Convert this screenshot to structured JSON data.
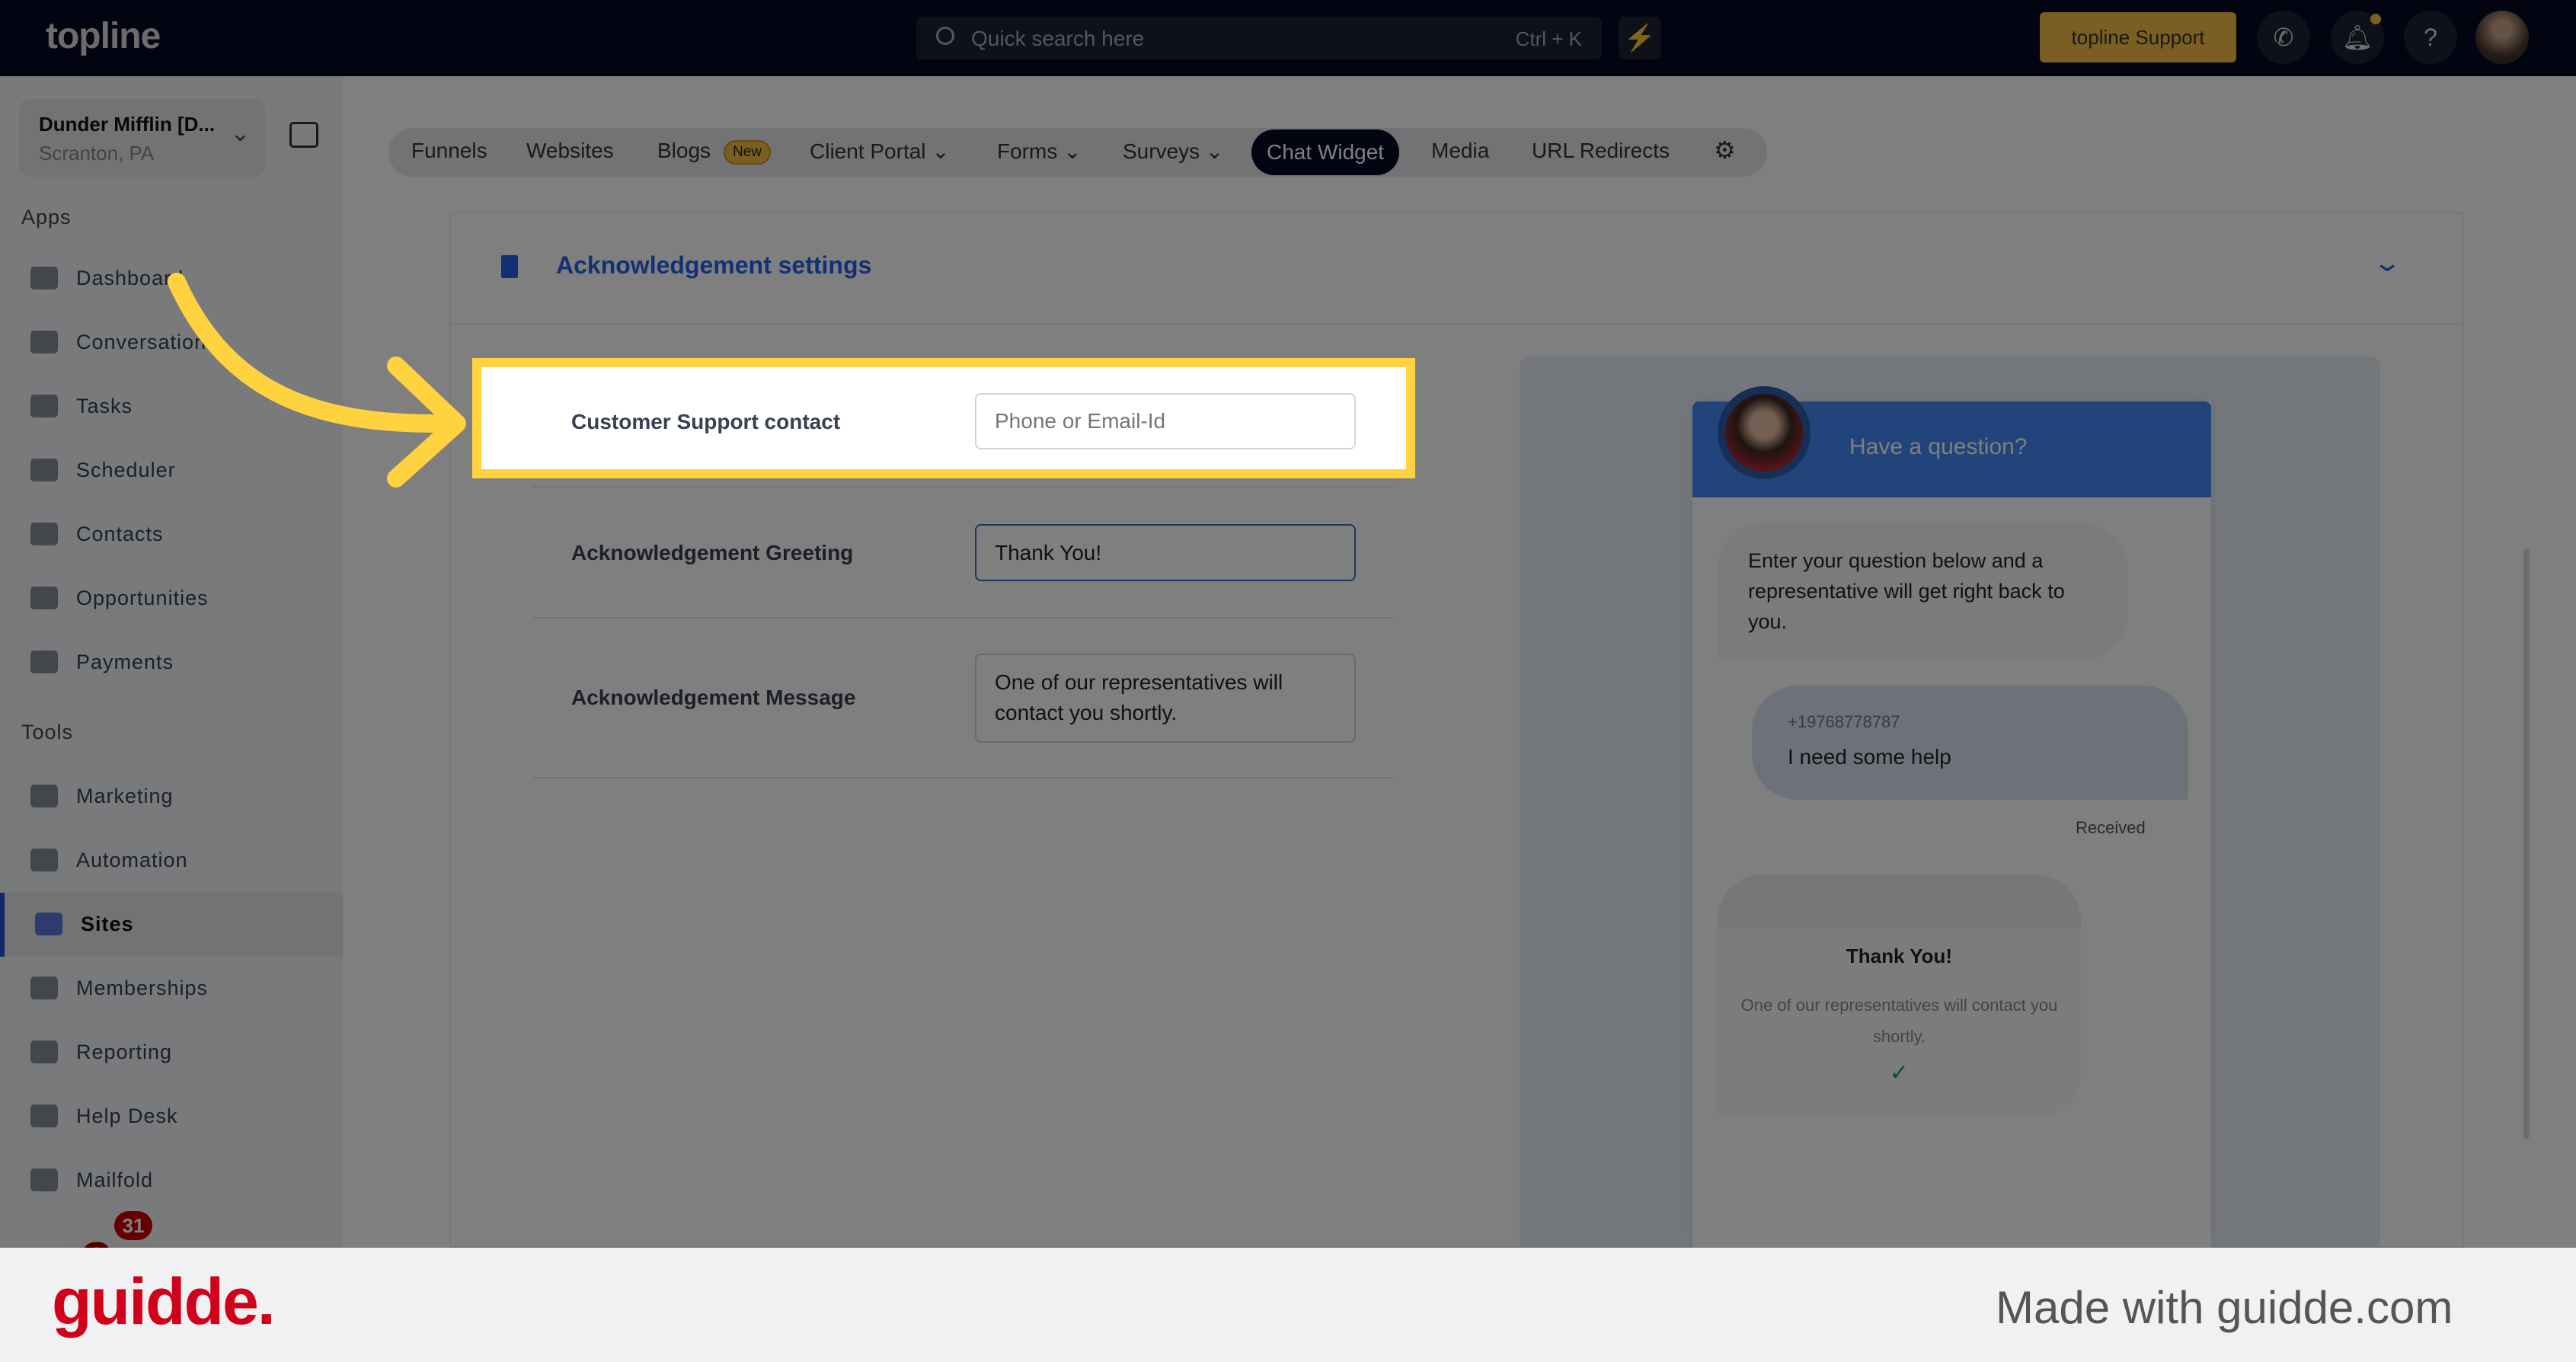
{
  "topbar": {
    "logo": "topline",
    "search_placeholder": "Quick search here",
    "search_shortcut": "Ctrl + K",
    "support_label": "topline Support",
    "accent": "#f4bd44"
  },
  "workspace": {
    "name": "Dunder Mifflin [D...",
    "location": "Scranton, PA"
  },
  "sidebar": {
    "apps_label": "Apps",
    "tools_label": "Tools",
    "apps": [
      {
        "label": "Dashboard",
        "icon": "dashboard-icon"
      },
      {
        "label": "Conversations",
        "icon": "chat-icon"
      },
      {
        "label": "Tasks",
        "icon": "tasks-icon"
      },
      {
        "label": "Scheduler",
        "icon": "calendar-icon"
      },
      {
        "label": "Contacts",
        "icon": "person-icon"
      },
      {
        "label": "Opportunities",
        "icon": "target-icon"
      },
      {
        "label": "Payments",
        "icon": "card-icon"
      }
    ],
    "tools": [
      {
        "label": "Marketing",
        "icon": "megaphone-icon"
      },
      {
        "label": "Automation",
        "icon": "gears-icon"
      },
      {
        "label": "Sites",
        "icon": "globe-icon",
        "active": true
      },
      {
        "label": "Memberships",
        "icon": "members-icon"
      },
      {
        "label": "Reporting",
        "icon": "pie-icon"
      },
      {
        "label": "Help Desk",
        "icon": "help-icon"
      },
      {
        "label": "Mailfold",
        "icon": "mail-icon"
      }
    ],
    "notification_count": "31"
  },
  "tabs": [
    {
      "label": "Funnels"
    },
    {
      "label": "Websites"
    },
    {
      "label": "Blogs",
      "badge": "New"
    },
    {
      "label": "Client Portal"
    },
    {
      "label": "Forms"
    },
    {
      "label": "Surveys"
    },
    {
      "label": "Chat Widget",
      "active": true
    },
    {
      "label": "Media"
    },
    {
      "label": "URL Redirects"
    }
  ],
  "section": {
    "title": "Acknowledgement settings",
    "fields": [
      {
        "label": "Customer Support contact",
        "placeholder": "Phone or Email-Id",
        "value": ""
      },
      {
        "label": "Acknowledgement Greeting",
        "value": "Thank You!"
      },
      {
        "label": "Acknowledgement Message",
        "value": "One of our representatives will contact you shortly."
      }
    ]
  },
  "preview": {
    "header": "Have a question?",
    "intro": "Enter your question below and a representative will get right back to you.",
    "phone": "+19768778787",
    "message": "I need some help",
    "status": "Received",
    "ack_title": "Thank You!",
    "ack_message": "One of our representatives will contact you shortly.",
    "header_color": "#428af4"
  },
  "footer": {
    "logo": "guidde.",
    "tagline": "Made with guidde.com"
  }
}
